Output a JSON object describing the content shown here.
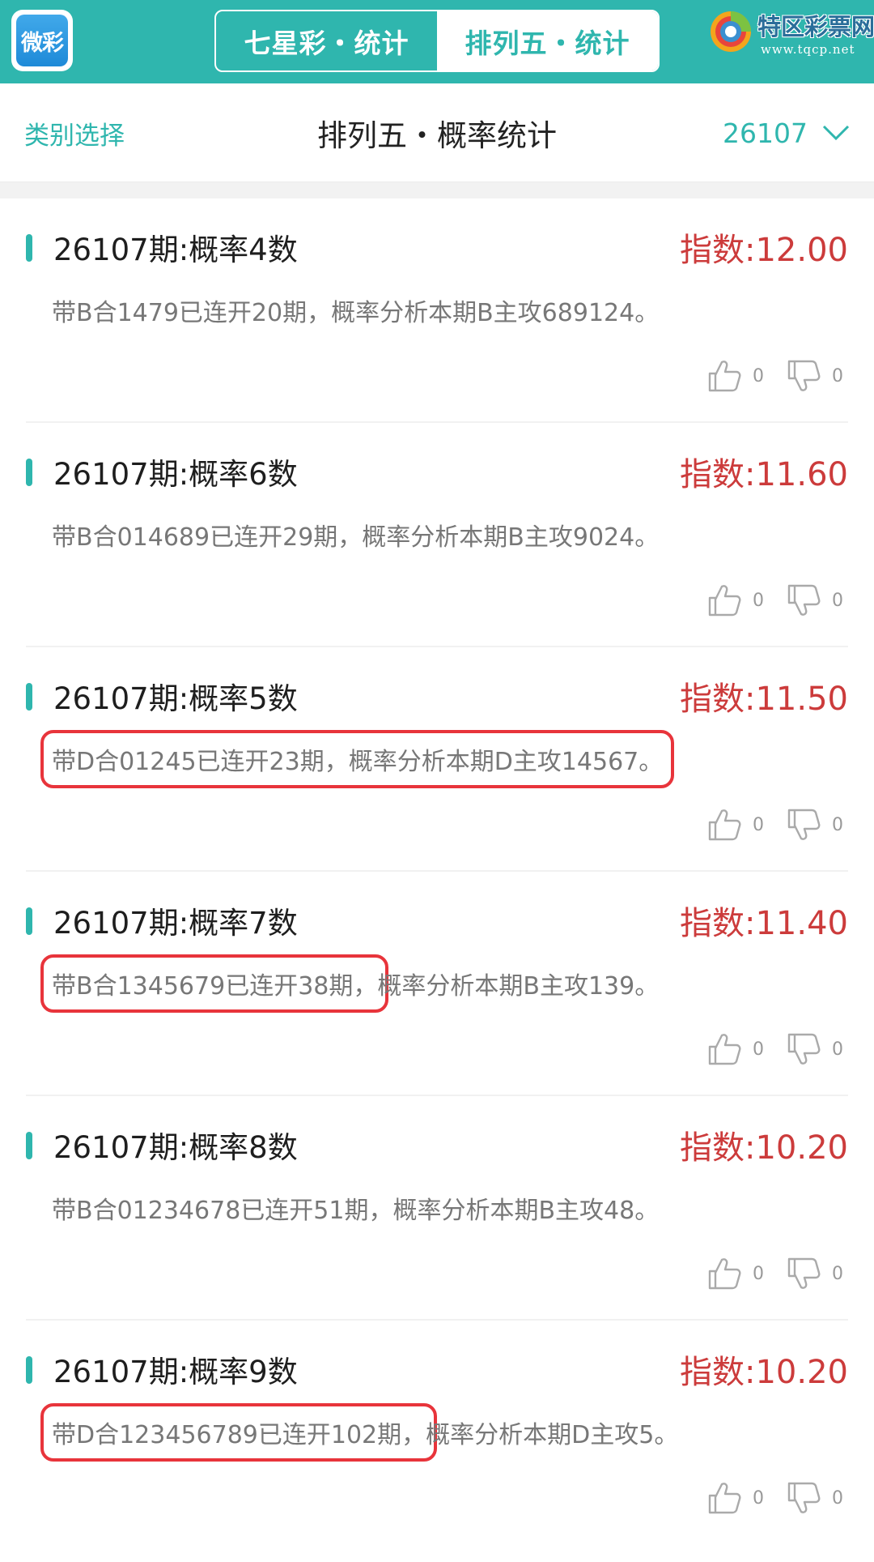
{
  "app": {
    "icon_text": "微彩"
  },
  "top_tabs": [
    {
      "label": "七星彩・统计",
      "active": false
    },
    {
      "label": "排列五・统计",
      "active": true
    }
  ],
  "brand": {
    "name": "特区彩票网",
    "url": "www.tqcp.net"
  },
  "nav": {
    "left": "类别选择",
    "title": "排列五・概率统计",
    "period": "26107"
  },
  "colors": {
    "accent": "#2fb6ae",
    "index_red": "#cc3b3b",
    "highlight_box": "#e8343b"
  },
  "items": [
    {
      "title": "26107期:概率4数",
      "index": "指数:12.00",
      "desc_highlight": "",
      "desc_rest": "带B合1479已连开20期，概率分析本期B主攻689124。",
      "likes": "0",
      "dislikes": "0"
    },
    {
      "title": "26107期:概率6数",
      "index": "指数:11.60",
      "desc_highlight": "",
      "desc_rest": "带B合014689已连开29期，概率分析本期B主攻9024。",
      "likes": "0",
      "dislikes": "0"
    },
    {
      "title": "26107期:概率5数",
      "index": "指数:11.50",
      "desc_highlight": "带D合01245已连开23期，概率分析本期D主攻14567。",
      "desc_rest": "",
      "likes": "0",
      "dislikes": "0"
    },
    {
      "title": "26107期:概率7数",
      "index": "指数:11.40",
      "desc_highlight": "带B合1345679已连开38期，",
      "desc_rest": "概率分析本期B主攻139。",
      "likes": "0",
      "dislikes": "0"
    },
    {
      "title": "26107期:概率8数",
      "index": "指数:10.20",
      "desc_highlight": "",
      "desc_rest": "带B合01234678已连开51期，概率分析本期B主攻48。",
      "likes": "0",
      "dislikes": "0"
    },
    {
      "title": "26107期:概率9数",
      "index": "指数:10.20",
      "desc_highlight": "带D合123456789已连开102期，",
      "desc_rest": "概率分析本期D主攻5。",
      "likes": "0",
      "dislikes": "0"
    }
  ]
}
